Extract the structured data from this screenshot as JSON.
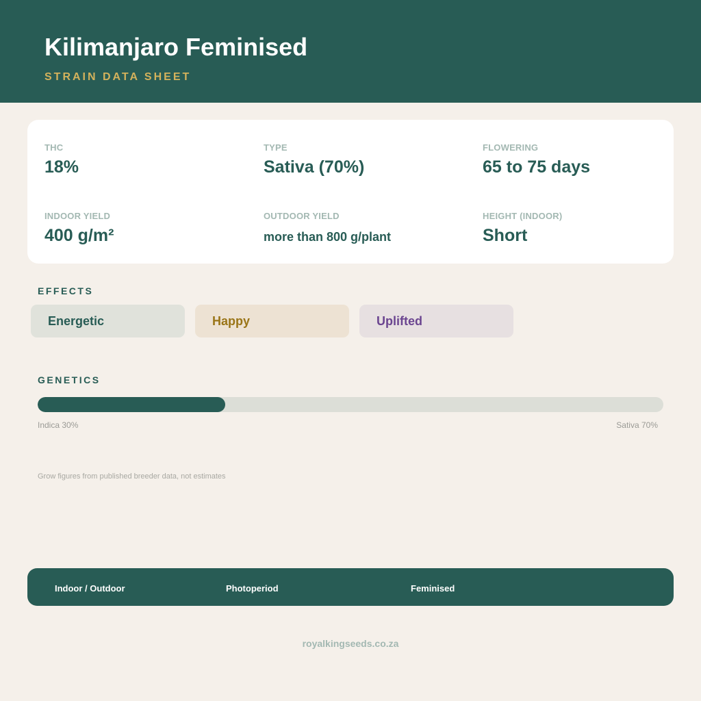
{
  "header": {
    "title": "Kilimanjaro Feminised",
    "subtitle": "STRAIN DATA SHEET"
  },
  "stats": {
    "thc": {
      "label": "THC",
      "value": "18%"
    },
    "type": {
      "label": "TYPE",
      "value": "Sativa (70%)"
    },
    "flowering": {
      "label": "FLOWERING",
      "value": "65 to 75 days"
    },
    "indoor_yield": {
      "label": "INDOOR YIELD",
      "value": "400 g/m²"
    },
    "outdoor_yield": {
      "label": "OUTDOOR YIELD",
      "value": "more than 800 g/plant"
    },
    "height": {
      "label": "HEIGHT (INDOOR)",
      "value": "Short"
    }
  },
  "effects": {
    "title": "EFFECTS",
    "items": [
      "Energetic",
      "Happy",
      "Uplifted"
    ]
  },
  "genetics": {
    "title": "GENETICS",
    "indica_percent": 30,
    "sativa_percent": 70,
    "indica_label": "Indica 30%",
    "sativa_label": "Sativa 70%"
  },
  "note": "Grow figures from published breeder data, not estimates",
  "footer": {
    "tags": [
      "Indoor / Outdoor",
      "Photoperiod",
      "Feminised"
    ]
  },
  "site": "royalkingseeds.co.za",
  "colors": {
    "primary": "#285c55",
    "accent": "#d4b25c",
    "background": "#f5f0ea"
  }
}
